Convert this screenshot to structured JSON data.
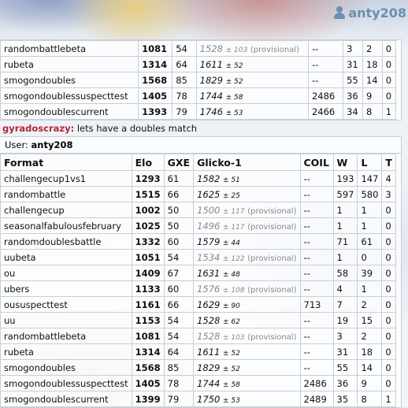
{
  "header": {
    "username": "anty208",
    "icon": "user-icon"
  },
  "columns": [
    "Format",
    "Elo",
    "GXE",
    "Glicko-1",
    "COIL",
    "W",
    "L",
    "T"
  ],
  "top_table": {
    "rows": [
      {
        "format": "randombattlebeta",
        "elo": "1081",
        "gxe": "54",
        "glicko": "1528",
        "dev": "± 103",
        "provisional": true,
        "coil": "--",
        "w": "3",
        "l": "2",
        "t": "0"
      },
      {
        "format": "rubeta",
        "elo": "1314",
        "gxe": "64",
        "glicko": "1611",
        "dev": "± 52",
        "provisional": false,
        "coil": "--",
        "w": "31",
        "l": "18",
        "t": "0"
      },
      {
        "format": "smogondoubles",
        "elo": "1568",
        "gxe": "85",
        "glicko": "1829",
        "dev": "± 52",
        "provisional": false,
        "coil": "--",
        "w": "55",
        "l": "14",
        "t": "0"
      },
      {
        "format": "smogondoublessuspecttest",
        "elo": "1405",
        "gxe": "78",
        "glicko": "1744",
        "dev": "± 58",
        "provisional": false,
        "coil": "2486",
        "w": "36",
        "l": "9",
        "t": "0"
      },
      {
        "format": "smogondoublescurrent",
        "elo": "1393",
        "gxe": "79",
        "glicko": "1746",
        "dev": "± 53",
        "provisional": false,
        "coil": "2466",
        "w": "34",
        "l": "8",
        "t": "1"
      }
    ]
  },
  "chat": {
    "user": "gyradoscrazy:",
    "message": "lets have a doubles match"
  },
  "user_panel": {
    "user_label": "User:",
    "user_name": "anty208",
    "provisional_label": "(provisional)",
    "rows": [
      {
        "format": "challengecup1vs1",
        "elo": "1293",
        "gxe": "61",
        "glicko": "1582",
        "dev": "± 51",
        "provisional": false,
        "coil": "--",
        "w": "193",
        "l": "147",
        "t": "4"
      },
      {
        "format": "randombattle",
        "elo": "1515",
        "gxe": "66",
        "glicko": "1625",
        "dev": "± 25",
        "provisional": false,
        "coil": "--",
        "w": "597",
        "l": "580",
        "t": "3"
      },
      {
        "format": "challengecup",
        "elo": "1002",
        "gxe": "50",
        "glicko": "1500",
        "dev": "± 117",
        "provisional": true,
        "coil": "--",
        "w": "1",
        "l": "1",
        "t": "0"
      },
      {
        "format": "seasonalfabulousfebruary",
        "elo": "1025",
        "gxe": "50",
        "glicko": "1496",
        "dev": "± 117",
        "provisional": true,
        "coil": "--",
        "w": "1",
        "l": "1",
        "t": "0"
      },
      {
        "format": "randomdoublesbattle",
        "elo": "1332",
        "gxe": "60",
        "glicko": "1579",
        "dev": "± 44",
        "provisional": false,
        "coil": "--",
        "w": "71",
        "l": "61",
        "t": "0"
      },
      {
        "format": "uubeta",
        "elo": "1051",
        "gxe": "54",
        "glicko": "1534",
        "dev": "± 122",
        "provisional": true,
        "coil": "--",
        "w": "1",
        "l": "0",
        "t": "0"
      },
      {
        "format": "ou",
        "elo": "1409",
        "gxe": "67",
        "glicko": "1631",
        "dev": "± 48",
        "provisional": false,
        "coil": "--",
        "w": "58",
        "l": "39",
        "t": "0"
      },
      {
        "format": "ubers",
        "elo": "1133",
        "gxe": "60",
        "glicko": "1576",
        "dev": "± 108",
        "provisional": true,
        "coil": "--",
        "w": "4",
        "l": "1",
        "t": "0"
      },
      {
        "format": "oususpecttest",
        "elo": "1161",
        "gxe": "66",
        "glicko": "1629",
        "dev": "± 90",
        "provisional": false,
        "coil": "713",
        "w": "7",
        "l": "2",
        "t": "0"
      },
      {
        "format": "uu",
        "elo": "1153",
        "gxe": "54",
        "glicko": "1528",
        "dev": "± 62",
        "provisional": false,
        "coil": "--",
        "w": "19",
        "l": "15",
        "t": "0"
      },
      {
        "format": "randombattlebeta",
        "elo": "1081",
        "gxe": "54",
        "glicko": "1528",
        "dev": "± 103",
        "provisional": true,
        "coil": "--",
        "w": "3",
        "l": "2",
        "t": "0"
      },
      {
        "format": "rubeta",
        "elo": "1314",
        "gxe": "64",
        "glicko": "1611",
        "dev": "± 52",
        "provisional": false,
        "coil": "--",
        "w": "31",
        "l": "18",
        "t": "0"
      },
      {
        "format": "smogondoubles",
        "elo": "1568",
        "gxe": "85",
        "glicko": "1829",
        "dev": "± 52",
        "provisional": false,
        "coil": "--",
        "w": "55",
        "l": "14",
        "t": "0"
      },
      {
        "format": "smogondoublessuspecttest",
        "elo": "1405",
        "gxe": "78",
        "glicko": "1744",
        "dev": "± 58",
        "provisional": false,
        "coil": "2486",
        "w": "36",
        "l": "9",
        "t": "0"
      },
      {
        "format": "smogondoublescurrent",
        "elo": "1399",
        "gxe": "79",
        "glicko": "1750",
        "dev": "± 53",
        "provisional": false,
        "coil": "2489",
        "w": "35",
        "l": "8",
        "t": "1"
      }
    ]
  },
  "colors": {
    "chat_user": "#b2263b",
    "username": "#6a8fb0",
    "provisional": "#888888"
  }
}
